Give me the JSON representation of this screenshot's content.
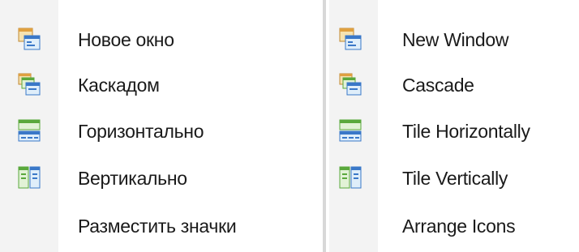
{
  "menu_ru": {
    "items": [
      {
        "label": "Новое окно",
        "icon": "new-window-icon"
      },
      {
        "label": "Каскадом",
        "icon": "cascade-icon"
      },
      {
        "label": "Горизонтально",
        "icon": "tile-horizontal-icon"
      },
      {
        "label": "Вертикально",
        "icon": "tile-vertical-icon"
      },
      {
        "label": "Разместить значки",
        "icon": ""
      }
    ]
  },
  "menu_en": {
    "items": [
      {
        "label": "New Window",
        "icon": "new-window-icon"
      },
      {
        "label": "Cascade",
        "icon": "cascade-icon"
      },
      {
        "label": "Tile Horizontally",
        "icon": "tile-horizontal-icon"
      },
      {
        "label": "Tile Vertically",
        "icon": "tile-vertical-icon"
      },
      {
        "label": "Arrange Icons",
        "icon": ""
      }
    ]
  },
  "colors": {
    "gutter": "#f3f3f3",
    "window_blue": "#3a78c8",
    "window_green": "#5aa83c",
    "window_orange": "#e0a040",
    "text": "#1a1a1a"
  }
}
